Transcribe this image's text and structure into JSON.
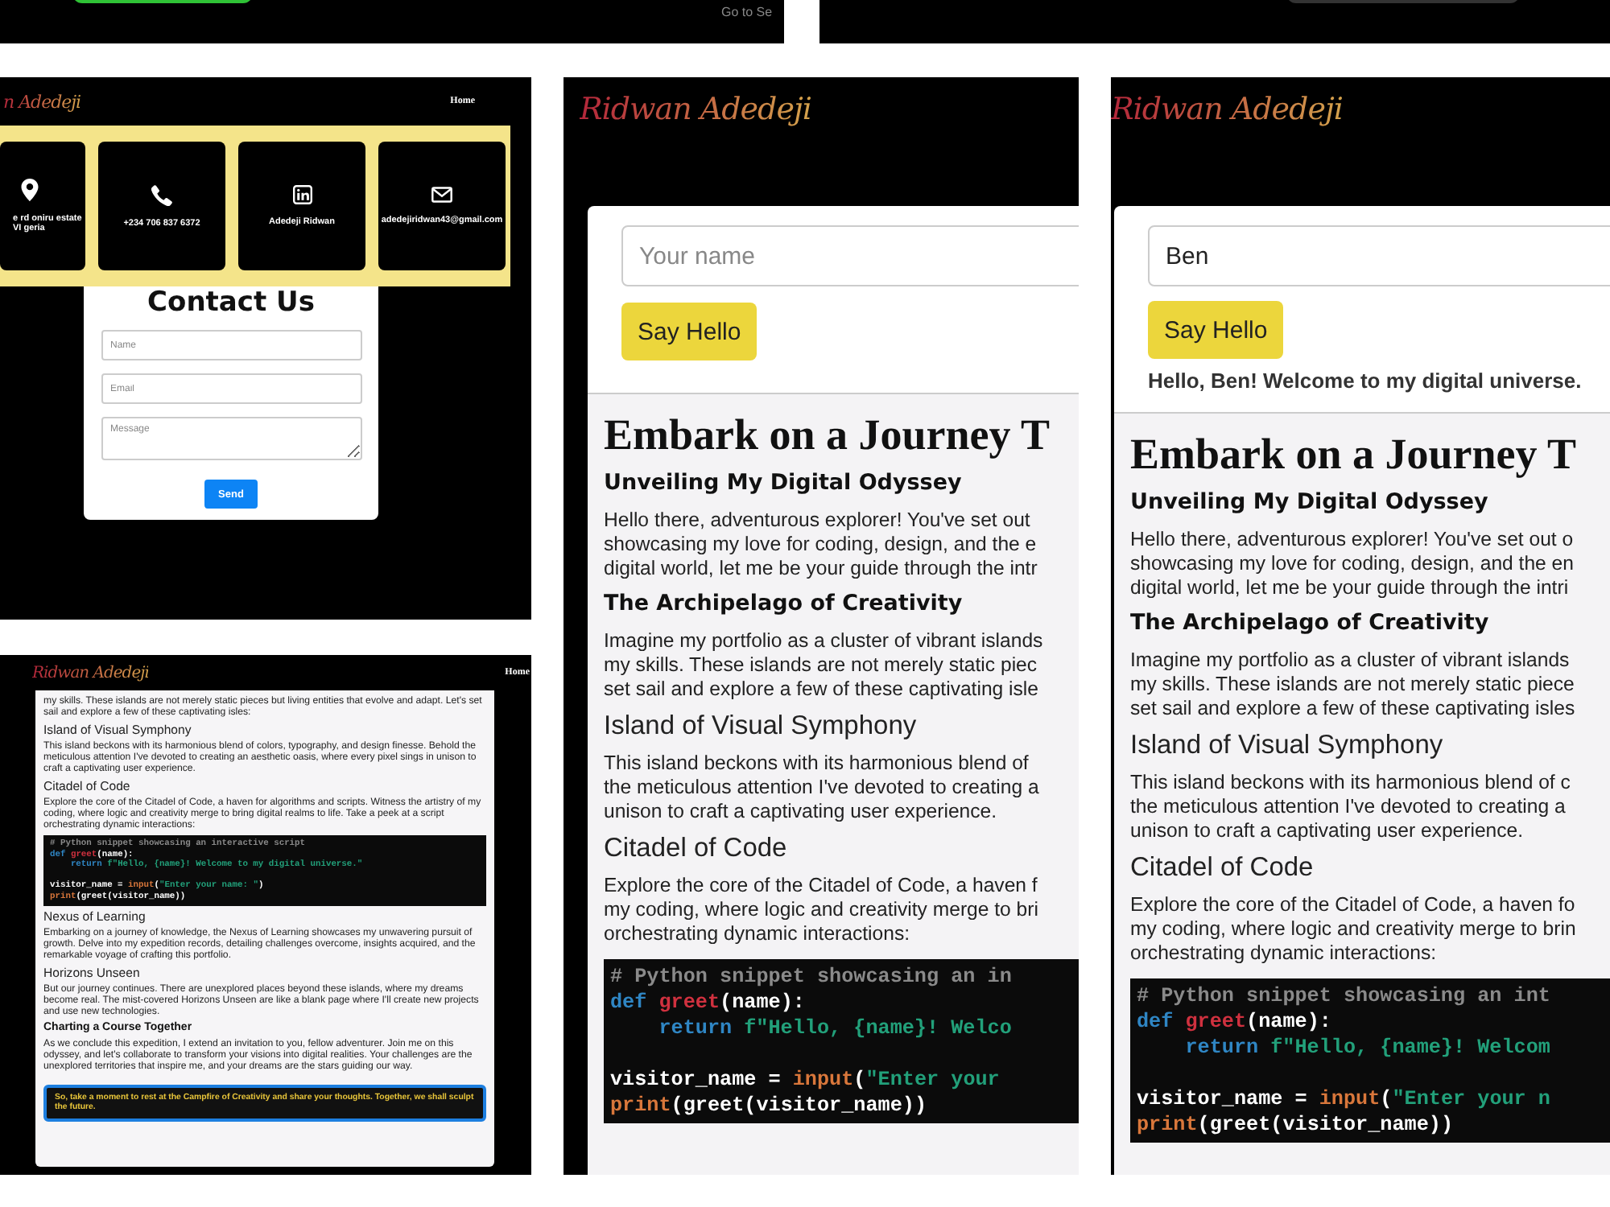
{
  "top_strip": {
    "link": "Go to Se"
  },
  "contact_page": {
    "logo": "n Adedeji",
    "nav": [
      "Home"
    ],
    "info_cards": [
      {
        "kind": "location",
        "text": "e rd oniru estate VI geria"
      },
      {
        "kind": "phone",
        "text": "+234 706 837 6372"
      },
      {
        "kind": "linkedin",
        "text": "Adedeji Ridwan"
      },
      {
        "kind": "email",
        "text": "adedejiridwan43@gmail.com"
      }
    ],
    "form": {
      "title": "Contact Us",
      "fields": [
        {
          "kind": "input",
          "placeholder": "Name"
        },
        {
          "kind": "input",
          "placeholder": "Email"
        },
        {
          "kind": "textarea",
          "placeholder": "Message"
        }
      ],
      "button": "Send"
    }
  },
  "article_page": {
    "logo": "Ridwan Adedeji",
    "nav": [
      "Home"
    ],
    "blocks": [
      {
        "kind": "paragraph",
        "text": "my skills. These islands are not merely static pieces but living entities that evolve and adapt. Let's set sail and explore a few of these captivating isles:"
      },
      {
        "kind": "section",
        "text": "Island of Visual Symphony"
      },
      {
        "kind": "paragraph",
        "text": "This island beckons with its harmonious blend of colors, typography, and design finesse. Behold the meticulous attention I've devoted to creating an aesthetic oasis, where every pixel sings in unison to craft a captivating user experience."
      },
      {
        "kind": "section",
        "text": "Citadel of Code"
      },
      {
        "kind": "paragraph",
        "text": "Explore the core of the Citadel of Code, a haven for algorithms and scripts. Witness the artistry of my coding, where logic and creativity merge to bring digital realms to life. Take a peek at a script orchestrating dynamic interactions:"
      },
      {
        "kind": "code",
        "lines": [
          {
            "tokens": [
              {
                "kind": "comment",
                "text": "# Python snippet showcasing an interactive script"
              }
            ]
          },
          {
            "tokens": [
              {
                "kind": "keyword",
                "text": "def "
              },
              {
                "kind": "func",
                "text": "greet"
              },
              {
                "kind": "plain",
                "text": "(name):"
              }
            ]
          },
          {
            "indent": true,
            "tokens": [
              {
                "kind": "keyword",
                "text": "return "
              },
              {
                "kind": "string",
                "text": "f\"Hello, {name}! Welcome to my digital universe.\""
              }
            ]
          },
          {
            "gap_before": true,
            "tokens": [
              {
                "kind": "plain",
                "text": "visitor_name = "
              },
              {
                "kind": "builtin",
                "text": "input"
              },
              {
                "kind": "plain",
                "text": "("
              },
              {
                "kind": "string",
                "text": "\"Enter your name: \""
              },
              {
                "kind": "plain",
                "text": ")"
              }
            ]
          },
          {
            "tokens": [
              {
                "kind": "builtin",
                "text": "print"
              },
              {
                "kind": "plain",
                "text": "(greet(visitor_name))"
              }
            ]
          }
        ]
      },
      {
        "kind": "section",
        "text": "Nexus of Learning"
      },
      {
        "kind": "paragraph",
        "text": "Embarking on a journey of knowledge, the Nexus of Learning showcases my unwavering pursuit of growth. Delve into my expedition records, detailing challenges overcome, insights acquired, and the remarkable voyage of crafting this portfolio."
      },
      {
        "kind": "section",
        "text": "Horizons Unseen"
      },
      {
        "kind": "paragraph",
        "text": "But our journey continues. There are unexplored places beyond these islands, where my dreams become real. The mist-covered Horizons Unseen are like a blank page where I'll create new projects and use new technologies."
      },
      {
        "kind": "subtitle",
        "text": "Charting a Course Together"
      },
      {
        "kind": "paragraph",
        "text": "As we conclude this expedition, I extend an invitation to you, fellow adventurer. Join me on this odyssey, and let's collaborate to transform your visions into digital realities. Your challenges are the unexplored territories that inspire me, and your dreams are the stars guiding our way."
      },
      {
        "kind": "callout",
        "text": "So, take a moment to rest at the Campfire of Creativity and share your thoughts. Together, we shall sculpt the future."
      }
    ]
  },
  "greeting_pages": [
    {
      "logo": "Ridwan Adedeji",
      "name_field": {
        "placeholder": "Your name"
      },
      "button": "Say Hello",
      "heading": "Embark on a Journey T",
      "blocks": [
        {
          "kind": "subtitle",
          "text": "Unveiling My Digital Odyssey"
        },
        {
          "kind": "lines",
          "lines": [
            "Hello there, adventurous explorer! You've set out",
            "showcasing my love for coding, design, and the e",
            "digital world, let me be your guide through the intr"
          ]
        },
        {
          "kind": "subtitle",
          "text": "The Archipelago of Creativity"
        },
        {
          "kind": "lines",
          "lines": [
            "Imagine my portfolio as a cluster of vibrant islands",
            "my skills. These islands are not merely static piec",
            "set sail and explore a few of these captivating isle"
          ]
        },
        {
          "kind": "section",
          "text": "Island of Visual Symphony"
        },
        {
          "kind": "lines",
          "lines": [
            "This island beckons with its harmonious blend of",
            "the meticulous attention I've devoted to creating a",
            "unison to craft a captivating user experience."
          ]
        },
        {
          "kind": "section",
          "text": "Citadel of Code"
        },
        {
          "kind": "lines",
          "lines": [
            "Explore the core of the Citadel of Code, a haven f",
            "my coding, where logic and creativity merge to bri",
            "orchestrating dynamic interactions:"
          ]
        },
        {
          "kind": "code",
          "lines": [
            {
              "tokens": [
                {
                  "kind": "comment",
                  "text": "# Python snippet showcasing an in"
                }
              ]
            },
            {
              "tokens": [
                {
                  "kind": "keyword",
                  "text": "def "
                },
                {
                  "kind": "func",
                  "text": "greet"
                },
                {
                  "kind": "plain",
                  "text": "(name):"
                }
              ]
            },
            {
              "indent": true,
              "tokens": [
                {
                  "kind": "keyword",
                  "text": "return "
                },
                {
                  "kind": "string",
                  "text": "f\"Hello, {name}! Welco"
                }
              ]
            },
            {
              "gap_before": true,
              "tokens": [
                {
                  "kind": "plain",
                  "text": "visitor_name = "
                },
                {
                  "kind": "builtin",
                  "text": "input"
                },
                {
                  "kind": "plain",
                  "text": "("
                },
                {
                  "kind": "string",
                  "text": "\"Enter your"
                }
              ]
            },
            {
              "tokens": [
                {
                  "kind": "builtin",
                  "text": "print"
                },
                {
                  "kind": "plain",
                  "text": "(greet(visitor_name))"
                }
              ]
            }
          ]
        }
      ]
    },
    {
      "logo": "Ridwan Adedeji",
      "name_field": {
        "value": "Ben"
      },
      "button": "Say Hello",
      "greeting": "Hello, Ben! Welcome to my digital universe.",
      "heading": "Embark on a Journey T",
      "blocks": [
        {
          "kind": "subtitle",
          "text": "Unveiling My Digital Odyssey"
        },
        {
          "kind": "lines",
          "lines": [
            "Hello there, adventurous explorer! You've set out o",
            "showcasing my love for coding, design, and the en",
            "digital world, let me be your guide through the intri"
          ]
        },
        {
          "kind": "subtitle",
          "text": "The Archipelago of Creativity"
        },
        {
          "kind": "lines",
          "lines": [
            "Imagine my portfolio as a cluster of vibrant islands",
            "my skills. These islands are not merely static piece",
            "set sail and explore a few of these captivating isles"
          ]
        },
        {
          "kind": "section",
          "text": "Island of Visual Symphony"
        },
        {
          "kind": "lines",
          "lines": [
            "This island beckons with its harmonious blend of c",
            "the meticulous attention I've devoted to creating a",
            "unison to craft a captivating user experience."
          ]
        },
        {
          "kind": "section",
          "text": "Citadel of Code"
        },
        {
          "kind": "lines",
          "lines": [
            "Explore the core of the Citadel of Code, a haven fo",
            "my coding, where logic and creativity merge to brin",
            "orchestrating dynamic interactions:"
          ]
        },
        {
          "kind": "code",
          "lines": [
            {
              "tokens": [
                {
                  "kind": "comment",
                  "text": "# Python snippet showcasing an int"
                }
              ]
            },
            {
              "tokens": [
                {
                  "kind": "keyword",
                  "text": "def "
                },
                {
                  "kind": "func",
                  "text": "greet"
                },
                {
                  "kind": "plain",
                  "text": "(name):"
                }
              ]
            },
            {
              "indent": true,
              "tokens": [
                {
                  "kind": "keyword",
                  "text": "return "
                },
                {
                  "kind": "string",
                  "text": "f\"Hello, {name}! Welcom"
                }
              ]
            },
            {
              "gap_before": true,
              "tokens": [
                {
                  "kind": "plain",
                  "text": "visitor_name = "
                },
                {
                  "kind": "builtin",
                  "text": "input"
                },
                {
                  "kind": "plain",
                  "text": "("
                },
                {
                  "kind": "string",
                  "text": "\"Enter your n"
                }
              ]
            },
            {
              "tokens": [
                {
                  "kind": "builtin",
                  "text": "print"
                },
                {
                  "kind": "plain",
                  "text": "(greet(visitor_name))"
                }
              ]
            }
          ]
        }
      ]
    }
  ]
}
